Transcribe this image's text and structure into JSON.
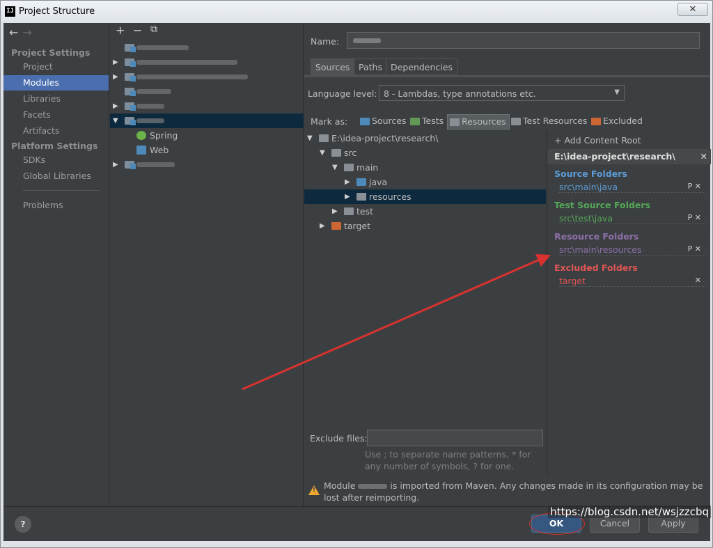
{
  "window": {
    "title": "Project Structure",
    "app_icon": "IJ",
    "close_glyph": "✕"
  },
  "nav": {
    "back": "←",
    "forward": "→",
    "project_settings_header": "Project Settings",
    "project_settings_items": [
      "Project",
      "Modules",
      "Libraries",
      "Facets",
      "Artifacts"
    ],
    "platform_settings_header": "Platform Settings",
    "platform_settings_items": [
      "SDKs",
      "Global Libraries"
    ],
    "other_items": [
      "Problems"
    ],
    "selected": "Modules"
  },
  "modules": {
    "toolbar": {
      "add": "+",
      "remove": "−",
      "copy": "⧉"
    },
    "children": [
      "Spring",
      "Web"
    ]
  },
  "content": {
    "name_label": "Name:",
    "tabs": [
      "Sources",
      "Paths",
      "Dependencies"
    ],
    "active_tab": "Sources",
    "language_level_label": "Language level:",
    "language_level_value": "8 - Lambdas, type annotations etc.",
    "mark_as_label": "Mark as:",
    "mark_buttons": [
      "Sources",
      "Tests",
      "Resources",
      "Test Resources",
      "Excluded"
    ],
    "tree": {
      "root": "E:\\idea-project\\research\\",
      "src": "src",
      "main": "main",
      "java": "java",
      "resources": "resources",
      "test": "test",
      "target": "target"
    },
    "root_panel": {
      "add_content_root": "Add Content Root",
      "root_path": "E:\\idea-project\\research\\",
      "source_folders_title": "Source Folders",
      "source_folder": "src\\main\\java",
      "test_source_folders_title": "Test Source Folders",
      "test_source_folder": "src\\test\\java",
      "resource_folders_title": "Resource Folders",
      "resource_folder": "src\\main\\resources",
      "excluded_folders_title": "Excluded Folders",
      "excluded_folder": "target"
    },
    "exclude_files_label": "Exclude files:",
    "exclude_hint": "Use ; to separate name patterns, * for any number of symbols, ? for one.",
    "warning_part1": "Module",
    "warning_part2": "is imported from Maven. Any changes made in its configuration may be lost after reimporting."
  },
  "buttons": {
    "help": "?",
    "ok": "OK",
    "cancel": "Cancel",
    "apply": "Apply"
  },
  "watermark": "https://blog.csdn.net/wsjzzcbq",
  "colors": {
    "sources": "#4e8ab9",
    "tests": "#629755",
    "resources": "#9876aa",
    "test_resources": "#8a8f96",
    "excluded": "#cc6633",
    "source_title": "#5c9bd6",
    "test_title": "#54a857",
    "resource_title": "#8d6fa8",
    "excluded_title": "#e05555",
    "annotation": "#d9322e"
  }
}
